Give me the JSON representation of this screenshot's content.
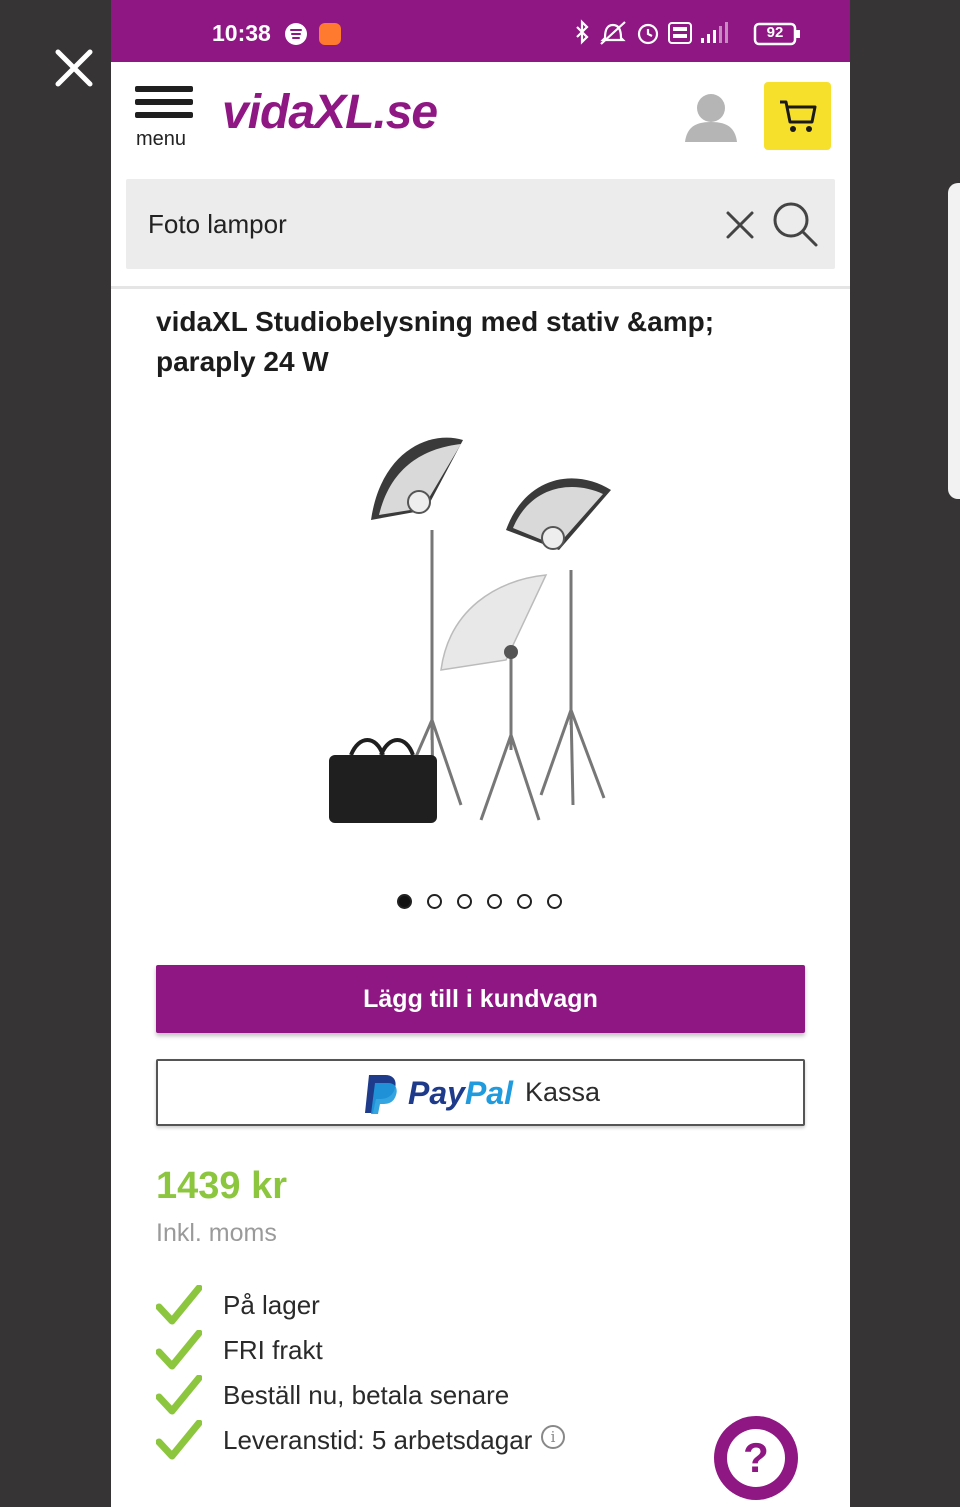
{
  "overlay": {
    "close_icon": "close-icon"
  },
  "status_bar": {
    "time": "10:38",
    "battery": "92",
    "icons": [
      "spotify-icon",
      "app-notification-icon",
      "bluetooth-icon",
      "mute-icon",
      "alarm-icon",
      "volte-icon",
      "4g-signal-icon",
      "battery-icon"
    ],
    "background": "#8f1783"
  },
  "header": {
    "menu_label": "menu",
    "logo_text": "vidaXL.se",
    "account_icon": "user-icon",
    "cart_icon": "cart-icon",
    "cart_bg": "#f7e02b"
  },
  "search": {
    "value": "Foto lampor",
    "clear_icon": "clear-icon",
    "search_icon": "search-icon"
  },
  "product": {
    "title": "vidaXL Studiobelysning med stativ &amp; paraply 24 W",
    "image_alt": "Studio lights with umbrellas and stands",
    "carousel": {
      "count": 6,
      "active": 1
    },
    "add_to_cart": "Lägg till i kundvagn",
    "paypal": {
      "pay": "Pay",
      "pal": "Pal",
      "kassa": "Kassa"
    },
    "price": "1439 kr",
    "vat_note": "Inkl. moms",
    "features": [
      "På lager",
      "FRI frakt",
      "Beställ nu, betala senare",
      "Leveranstid: 5 arbetsdagar"
    ]
  },
  "help_button": {
    "label": "?"
  },
  "colors": {
    "brand_purple": "#8f1783",
    "price_green": "#8cc63f",
    "check_green": "#8cc63f"
  }
}
